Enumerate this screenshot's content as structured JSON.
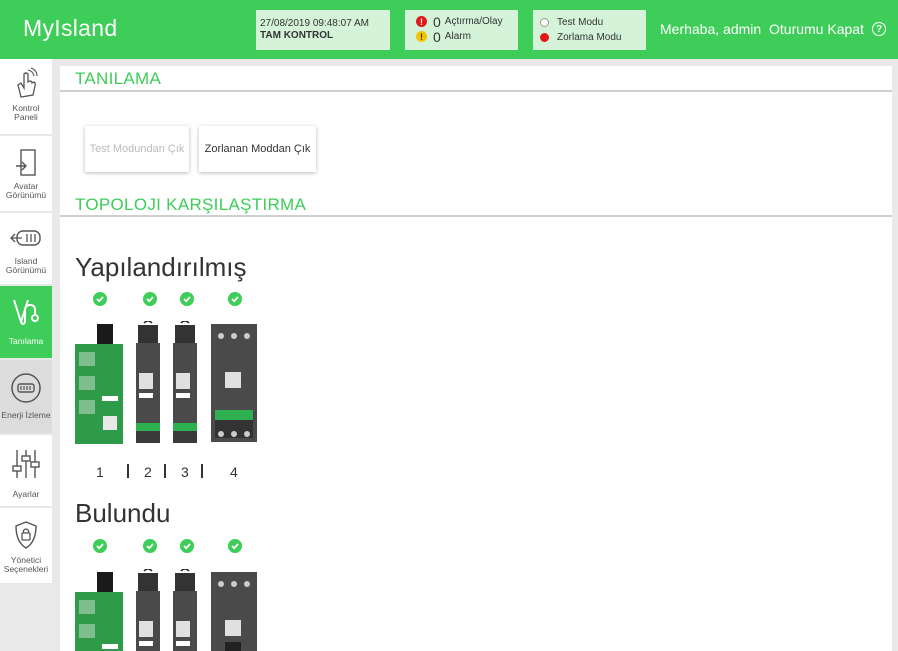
{
  "header": {
    "app_title": "MyIsland",
    "datetime": "27/08/2019 09:48:07 AM",
    "control": "TAM KONTROL",
    "trip_count": "0",
    "trip_label": "Açtırma/Olay",
    "alarm_count": "0",
    "alarm_label": "Alarm",
    "test_mode_label": "Test Modu",
    "forced_mode_label": "Zorlama Modu",
    "greeting": "Merhaba, admin",
    "logout": "Oturumu Kapat",
    "help_symbol": "?",
    "trip_symbol": "!",
    "alarm_symbol": "!"
  },
  "sidebar": {
    "items": [
      {
        "label_1": "Kontrol",
        "label_2": "Paneli",
        "icon": "hand-icon"
      },
      {
        "label_1": "Avatar",
        "label_2": "Görünümü",
        "icon": "avatar-icon"
      },
      {
        "label_1": "Island",
        "label_2": "Görünümü",
        "icon": "island-icon"
      },
      {
        "label_1": "Tanılama",
        "label_2": "",
        "icon": "stethoscope-icon"
      },
      {
        "label_1": "Enerji İzleme",
        "label_2": "",
        "icon": "meter-icon"
      },
      {
        "label_1": "Ayarlar",
        "label_2": "",
        "icon": "sliders-icon"
      },
      {
        "label_1": "Yönetici",
        "label_2": "Seçenekleri",
        "icon": "shield-lock-icon"
      }
    ]
  },
  "main": {
    "diag_title": "TANILAMA",
    "btn_exit_test": "Test Modundan Çık",
    "btn_exit_forced": "Zorlanan Moddan Çık",
    "topology_title": "TOPOLOJI KARŞILAŞTIRMA",
    "configured_heading": "Yapılandırılmış",
    "found_heading": "Bulundu",
    "module_indices": [
      "1",
      "2",
      "3",
      "4"
    ]
  },
  "colors": {
    "accent": "#3dcd58",
    "alarm_red": "#e01a1a",
    "alarm_yellow": "#f5c400"
  }
}
